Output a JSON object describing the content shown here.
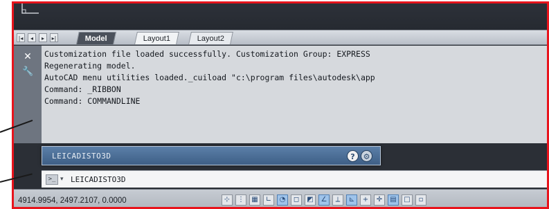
{
  "tabs": {
    "nav_first": "|◂",
    "nav_prev": "◂",
    "nav_next": "▸",
    "nav_last": "▸|",
    "items": [
      "Model",
      "Layout1",
      "Layout2"
    ]
  },
  "history": {
    "lines": [
      "Customization file loaded successfully. Customization Group: EXPRESS",
      "Regenerating model.",
      "AutoCAD menu utilities loaded._cuiload \"c:\\program files\\autodesk\\app",
      "Command: _RIBBON",
      "Command: COMMANDLINE"
    ]
  },
  "popup": {
    "title": "LEICADISTO3D",
    "help_glyph": "?",
    "settings_glyph": "⚙"
  },
  "command_line": {
    "text": "LEICADISTO3D",
    "dropdown_glyph": "▾"
  },
  "status": {
    "coordinates": "4914.9954, 2497.2107, 0.0000",
    "buttons": [
      {
        "icon": "infer-constraints-icon",
        "glyph": "⊹",
        "on": false
      },
      {
        "icon": "snap-mode-icon",
        "glyph": "⋮",
        "on": false
      },
      {
        "icon": "grid-display-icon",
        "glyph": "▦",
        "on": false
      },
      {
        "icon": "ortho-mode-icon",
        "glyph": "∟",
        "on": false
      },
      {
        "icon": "polar-tracking-icon",
        "glyph": "◔",
        "on": true
      },
      {
        "icon": "object-snap-icon",
        "glyph": "◻",
        "on": false
      },
      {
        "icon": "3d-object-snap-icon",
        "glyph": "◩",
        "on": false
      },
      {
        "icon": "object-snap-tracking-icon",
        "glyph": "∠",
        "on": true
      },
      {
        "icon": "dynamic-ucs-icon",
        "glyph": "⟂",
        "on": false
      },
      {
        "icon": "dynamic-input-icon",
        "glyph": "⊾",
        "on": true
      },
      {
        "icon": "lineweight-icon",
        "glyph": "+",
        "on": false
      },
      {
        "icon": "transparency-icon",
        "glyph": "✛",
        "on": false
      },
      {
        "icon": "quick-properties-icon",
        "glyph": "▤",
        "on": true
      },
      {
        "icon": "selection-cycling-icon",
        "glyph": "□",
        "on": false
      },
      {
        "icon": "annotation-monitor-icon",
        "glyph": "▫",
        "on": false
      }
    ]
  },
  "colors": {
    "annotation_frame": "#e8141c",
    "popup_bar": "#4a6d96",
    "history_background": "#d6d9dd"
  }
}
